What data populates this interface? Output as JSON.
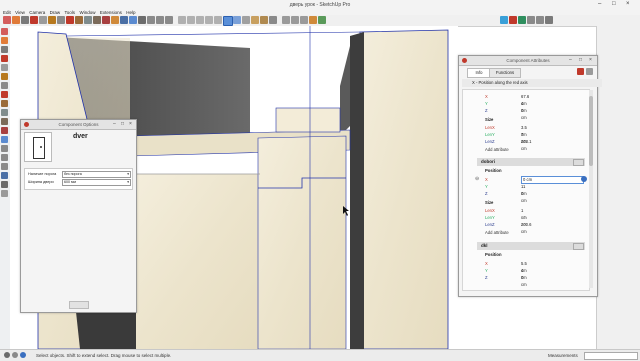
{
  "window": {
    "title": "дверь урок - SketchUp Pro"
  },
  "menu": [
    "Edit",
    "View",
    "Camera",
    "Draw",
    "Tools",
    "Window",
    "Extensions",
    "Help"
  ],
  "status": {
    "text": "Select objects. Shift to extend select. Drag mouse to select multiple.",
    "measurements_label": "Measurements"
  },
  "component_options": {
    "panel_title": "Component Options",
    "component_name": "dver",
    "options": [
      {
        "label": "Наличие порога",
        "value": "без порога"
      },
      {
        "label": "Ширина двери",
        "value": "600 мм"
      }
    ],
    "apply_label": ""
  },
  "component_attributes": {
    "panel_title": "Component Attributes",
    "tabs": {
      "info": "Info",
      "functions": "Functions"
    },
    "hint": "X - Position along the red axis",
    "top_rows": [
      {
        "k": "X",
        "v": "67.6 cm",
        "color": "#c0392b"
      },
      {
        "k": "Y",
        "v": "4 cm",
        "color": "#27ae60"
      },
      {
        "k": "Z",
        "v": "0 cm",
        "color": "#2c3e8f"
      }
    ],
    "top_size_label": "Size",
    "top_size": [
      {
        "k": "LenX",
        "v": "3.5 cm",
        "color": "#c0392b"
      },
      {
        "k": "LenY",
        "v": "7 cm",
        "color": "#27ae60"
      },
      {
        "k": "LenZ",
        "v": "203.1 cm",
        "color": "#2c3e8f"
      }
    ],
    "add_attribute": "Add attribute",
    "dobori": {
      "name": "dobori",
      "position_label": "Position",
      "rows": [
        {
          "k": "X",
          "v": "0 cm",
          "color": "#c0392b"
        },
        {
          "k": "Y",
          "v": "11 cm",
          "color": "#27ae60"
        },
        {
          "k": "Z",
          "v": "0 cm",
          "color": "#2c3e8f"
        }
      ],
      "size_label": "Size",
      "size": [
        {
          "k": "LenX",
          "v": "1 cm",
          "color": "#c0392b"
        },
        {
          "k": "LenY",
          "v": "10 cm",
          "color": "#27ae60"
        },
        {
          "k": "LenZ",
          "v": "200.6 cm",
          "color": "#2c3e8f"
        }
      ],
      "add_attribute": "Add attribute"
    },
    "dkl": {
      "name": "dkl",
      "position_label": "Position",
      "rows": [
        {
          "k": "X",
          "v": "5.5 cm",
          "color": "#c0392b"
        },
        {
          "k": "Y",
          "v": "4 cm",
          "color": "#27ae60"
        },
        {
          "k": "Z",
          "v": "0 cm",
          "color": "#2c3e8f"
        }
      ]
    }
  }
}
